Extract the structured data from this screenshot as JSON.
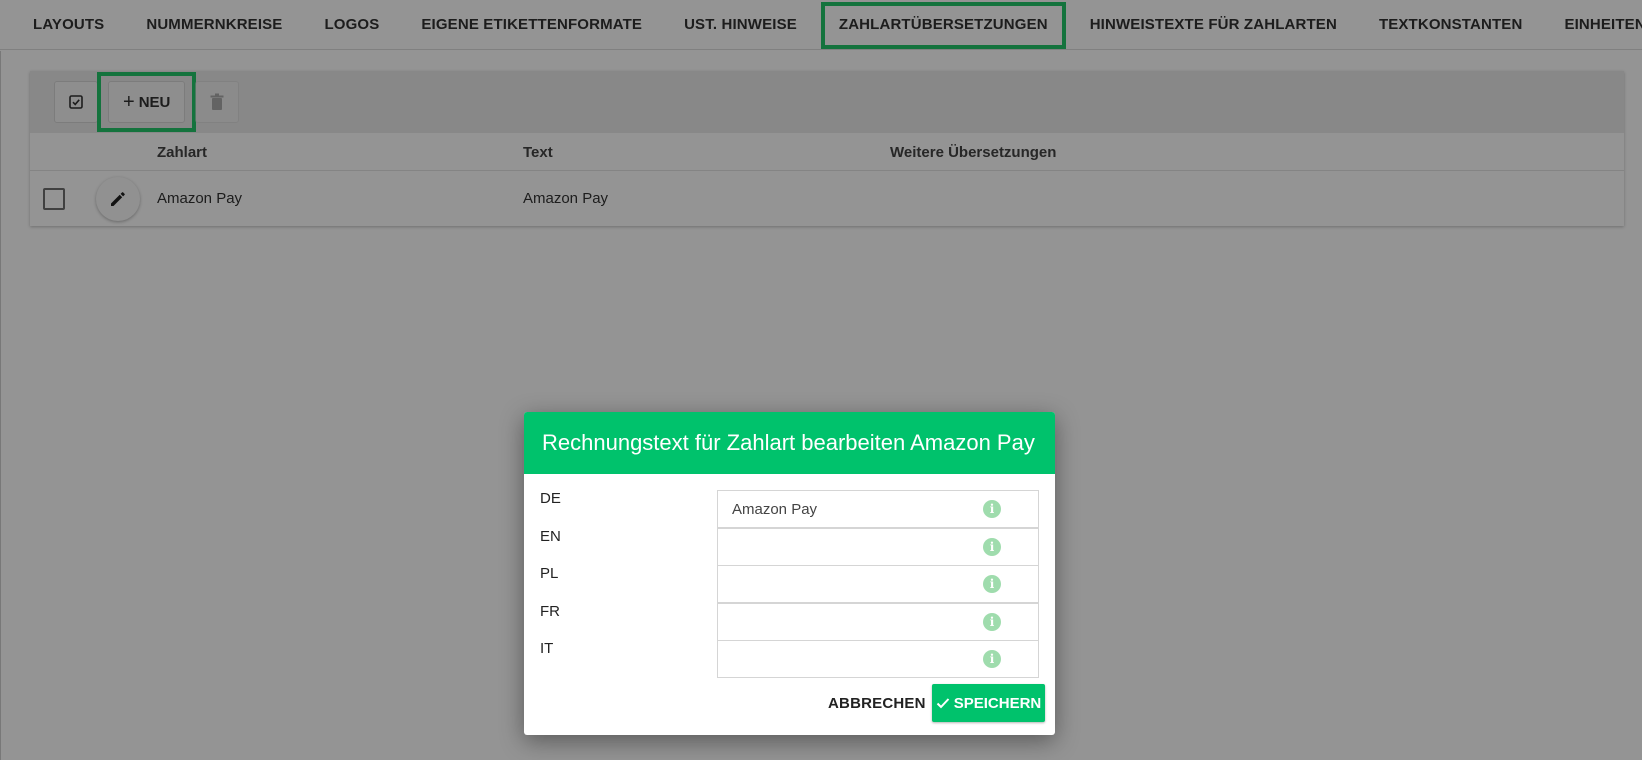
{
  "tabs": [
    {
      "label": "LAYOUTS"
    },
    {
      "label": "NUMMERNKREISE"
    },
    {
      "label": "LOGOS"
    },
    {
      "label": "EIGENE ETIKETTENFORMATE"
    },
    {
      "label": "UST. HINWEISE"
    },
    {
      "label": "ZAHLARTÜBERSETZUNGEN",
      "active": true
    },
    {
      "label": "HINWEISTEXTE FÜR ZAHLARTEN"
    },
    {
      "label": "TEXTKONSTANTEN"
    },
    {
      "label": "EINHEITEN"
    }
  ],
  "toolbar": {
    "new_label": "NEU",
    "icons": [
      "select-all-icon",
      "plus-icon",
      "trash-icon"
    ]
  },
  "table": {
    "headers": [
      "Zahlart",
      "Text",
      "Weitere Übersetzungen"
    ],
    "rows": [
      {
        "zahlart": "Amazon Pay",
        "text": "Amazon Pay",
        "weitere": ""
      }
    ]
  },
  "dialog": {
    "title": "Rechnungstext für Zahlart bearbeiten Amazon Pay",
    "fields": [
      {
        "lang": "DE",
        "value": "Amazon Pay"
      },
      {
        "lang": "EN",
        "value": ""
      },
      {
        "lang": "PL",
        "value": ""
      },
      {
        "lang": "FR",
        "value": ""
      },
      {
        "lang": "IT",
        "value": ""
      }
    ],
    "cancel_label": "ABBRECHEN",
    "save_label": "SPEICHERN"
  },
  "colors": {
    "accent": "#00c26c",
    "highlight": "#24c769",
    "info_icon": "#9fdcad"
  }
}
